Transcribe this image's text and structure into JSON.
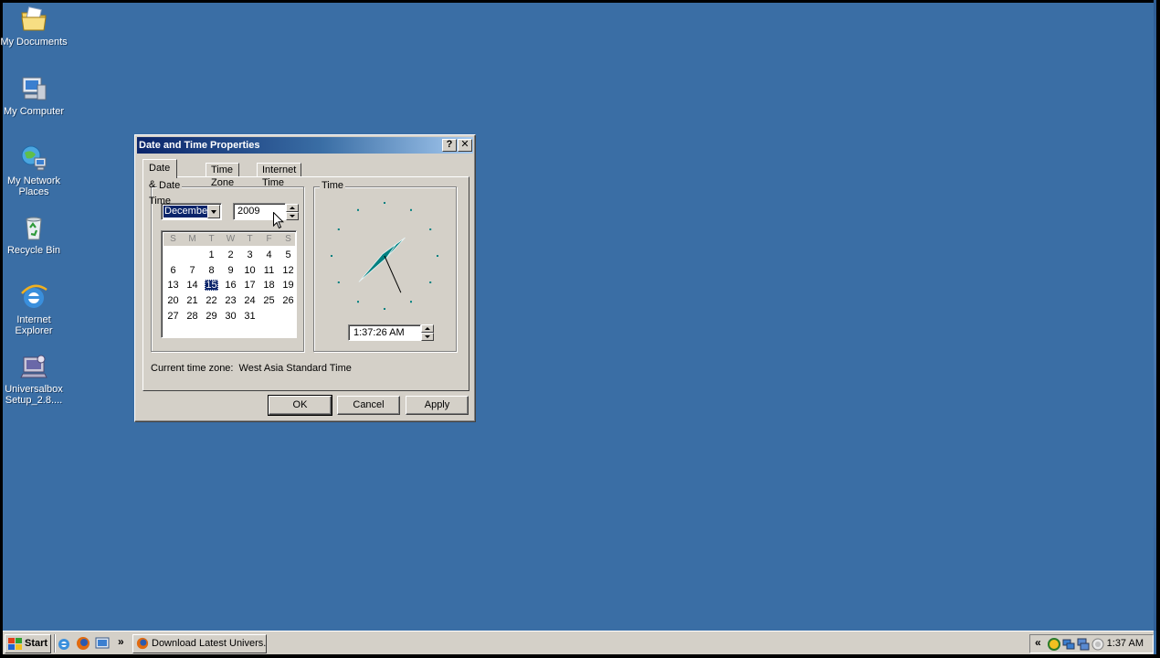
{
  "desktop": {
    "icons": [
      {
        "label": "My Documents",
        "icon": "my-documents-icon"
      },
      {
        "label": "My Computer",
        "icon": "my-computer-icon"
      },
      {
        "label_line1": "My Network",
        "label_line2": "Places",
        "icon": "network-places-icon"
      },
      {
        "label": "Recycle Bin",
        "icon": "recycle-bin-icon"
      },
      {
        "label_line1": "Internet",
        "label_line2": "Explorer",
        "icon": "internet-explorer-icon"
      },
      {
        "label_line1": "Universalbox",
        "label_line2": "Setup_2.8....",
        "icon": "installer-icon"
      }
    ]
  },
  "dialog": {
    "title": "Date and Time Properties",
    "help_label": "?",
    "close_label": "✕",
    "tabs": [
      "Date & Time",
      "Time Zone",
      "Internet Time"
    ],
    "active_tab": "Date & Time",
    "date_group": "Date",
    "time_group": "Time",
    "month": "December",
    "year": "2009",
    "weekdays": [
      "S",
      "M",
      "T",
      "W",
      "T",
      "F",
      "S"
    ],
    "calendar_weeks": [
      [
        "",
        "",
        "1",
        "2",
        "3",
        "4",
        "5"
      ],
      [
        "6",
        "7",
        "8",
        "9",
        "10",
        "11",
        "12"
      ],
      [
        "13",
        "14",
        "15",
        "16",
        "17",
        "18",
        "19"
      ],
      [
        "20",
        "21",
        "22",
        "23",
        "24",
        "25",
        "26"
      ],
      [
        "27",
        "28",
        "29",
        "30",
        "31",
        "",
        ""
      ]
    ],
    "selected_day": "15",
    "time_value": "1:37:26 AM",
    "clock": {
      "hour": 1,
      "minute": 37,
      "second": 26,
      "hand_color": "#008080"
    },
    "timezone_label": "Current time zone:",
    "timezone_value": "West Asia Standard Time",
    "buttons": {
      "ok": "OK",
      "cancel": "Cancel",
      "apply": "Apply"
    }
  },
  "taskbar": {
    "start_label": "Start",
    "chevron": "»",
    "task_label": "Download Latest Univers...",
    "tray_chevron": "«",
    "clock": "1:37 AM"
  },
  "colors": {
    "desktop": "#3a6ea5",
    "titlebar_start": "#0a246a",
    "titlebar_end": "#a6caf0",
    "face": "#d4d0c8"
  }
}
